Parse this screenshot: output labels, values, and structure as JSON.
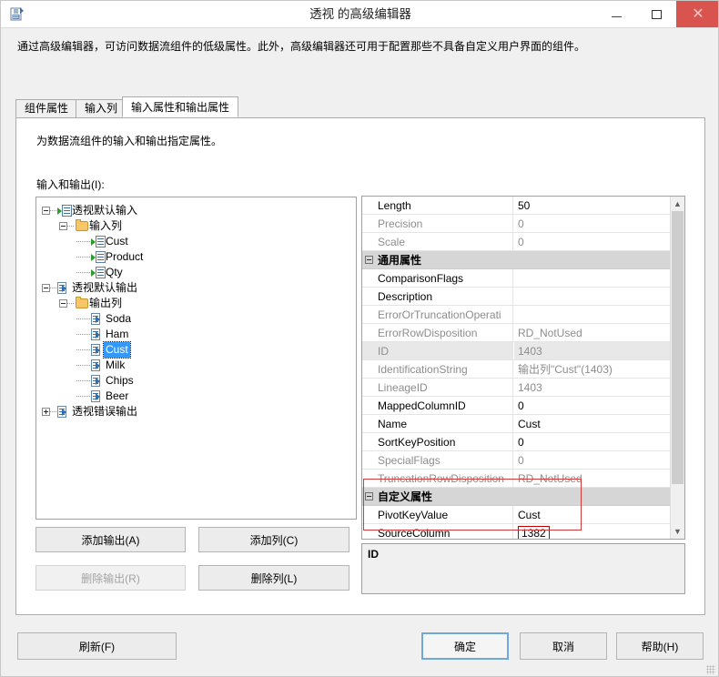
{
  "window": {
    "title": "透视 的高级编辑器",
    "app_icon": "advanced-editor-icon",
    "minimize_label": "最小化",
    "maximize_label": "最大化",
    "close_label": "关闭",
    "close_color": "#d9534f"
  },
  "intro": "通过高级编辑器，可访问数据流组件的低级属性。此外，高级编辑器还可用于配置那些不具备自定义用户界面的组件。",
  "tabs": [
    {
      "label": "组件属性",
      "active": false
    },
    {
      "label": "输入列",
      "active": false
    },
    {
      "label": "输入属性和输出属性",
      "active": true
    }
  ],
  "panel": {
    "description": "为数据流组件的输入和输出指定属性。",
    "tree_label": "输入和输出(I):"
  },
  "tree": [
    {
      "label": "透视默认输入",
      "icon": "input-icon",
      "indent": 0,
      "expander": "minus",
      "selected": false
    },
    {
      "label": "输入列",
      "icon": "folder-icon",
      "indent": 1,
      "expander": "minus",
      "selected": false
    },
    {
      "label": "Cust",
      "icon": "input-column-icon",
      "indent": 2,
      "expander": "none",
      "selected": false
    },
    {
      "label": "Product",
      "icon": "input-column-icon",
      "indent": 2,
      "expander": "none",
      "selected": false
    },
    {
      "label": "Qty",
      "icon": "input-column-icon",
      "indent": 2,
      "expander": "none",
      "selected": false
    },
    {
      "label": "透视默认输出",
      "icon": "output-icon",
      "indent": 0,
      "expander": "minus",
      "selected": false
    },
    {
      "label": "输出列",
      "icon": "folder-icon",
      "indent": 1,
      "expander": "minus",
      "selected": false
    },
    {
      "label": "Soda",
      "icon": "output-column-icon",
      "indent": 2,
      "expander": "none",
      "selected": false
    },
    {
      "label": "Ham",
      "icon": "output-column-icon",
      "indent": 2,
      "expander": "none",
      "selected": false
    },
    {
      "label": "Cust",
      "icon": "output-column-icon",
      "indent": 2,
      "expander": "none",
      "selected": true
    },
    {
      "label": "Milk",
      "icon": "output-column-icon",
      "indent": 2,
      "expander": "none",
      "selected": false
    },
    {
      "label": "Chips",
      "icon": "output-column-icon",
      "indent": 2,
      "expander": "none",
      "selected": false
    },
    {
      "label": "Beer",
      "icon": "output-column-icon",
      "indent": 2,
      "expander": "none",
      "selected": false
    },
    {
      "label": "透视错误输出",
      "icon": "output-icon",
      "indent": 0,
      "expander": "plus",
      "selected": false
    }
  ],
  "tree_buttons": {
    "add_output": "添加输出(A)",
    "add_column": "添加列(C)",
    "remove_output": "删除输出(R)",
    "remove_column": "删除列(L)",
    "remove_output_disabled": true
  },
  "grid": {
    "rows": [
      {
        "kind": "prop",
        "name": "Length",
        "value": "50",
        "readonly": false,
        "shaded": false
      },
      {
        "kind": "prop",
        "name": "Precision",
        "value": "0",
        "readonly": true,
        "shaded": false
      },
      {
        "kind": "prop",
        "name": "Scale",
        "value": "0",
        "readonly": true,
        "shaded": false
      },
      {
        "kind": "category",
        "name": "通用属性"
      },
      {
        "kind": "prop",
        "name": "ComparisonFlags",
        "value": "",
        "readonly": false,
        "shaded": false
      },
      {
        "kind": "prop",
        "name": "Description",
        "value": "",
        "readonly": false,
        "shaded": false
      },
      {
        "kind": "prop",
        "name": "ErrorOrTruncationOperati",
        "value": "",
        "readonly": true,
        "shaded": false
      },
      {
        "kind": "prop",
        "name": "ErrorRowDisposition",
        "value": "RD_NotUsed",
        "readonly": true,
        "shaded": false
      },
      {
        "kind": "prop",
        "name": "ID",
        "value": "1403",
        "readonly": true,
        "shaded": true
      },
      {
        "kind": "prop",
        "name": "IdentificationString",
        "value": "输出列\"Cust\"(1403)",
        "readonly": true,
        "shaded": false
      },
      {
        "kind": "prop",
        "name": "LineageID",
        "value": "1403",
        "readonly": true,
        "shaded": false
      },
      {
        "kind": "prop",
        "name": "MappedColumnID",
        "value": "0",
        "readonly": false,
        "shaded": false
      },
      {
        "kind": "prop",
        "name": "Name",
        "value": "Cust",
        "readonly": false,
        "shaded": false
      },
      {
        "kind": "prop",
        "name": "SortKeyPosition",
        "value": "0",
        "readonly": false,
        "shaded": false
      },
      {
        "kind": "prop",
        "name": "SpecialFlags",
        "value": "0",
        "readonly": true,
        "shaded": false
      },
      {
        "kind": "prop",
        "name": "TruncationRowDisposition",
        "value": "RD_NotUsed",
        "readonly": true,
        "shaded": false
      },
      {
        "kind": "category",
        "name": "自定义属性"
      },
      {
        "kind": "prop",
        "name": "PivotKeyValue",
        "value": "Cust",
        "readonly": false,
        "shaded": false
      },
      {
        "kind": "prop",
        "name": "SourceColumn",
        "value": "1382",
        "readonly": false,
        "shaded": false,
        "editing": true
      }
    ],
    "highlight_color": "#d03a3a",
    "scroll_up_icon": "chevron-up-icon",
    "scroll_down_icon": "chevron-down-icon"
  },
  "description_panel": {
    "title": "ID",
    "text": ""
  },
  "footer": {
    "refresh": "刷新(F)",
    "ok": "确定",
    "cancel": "取消",
    "help": "帮助(H)"
  }
}
